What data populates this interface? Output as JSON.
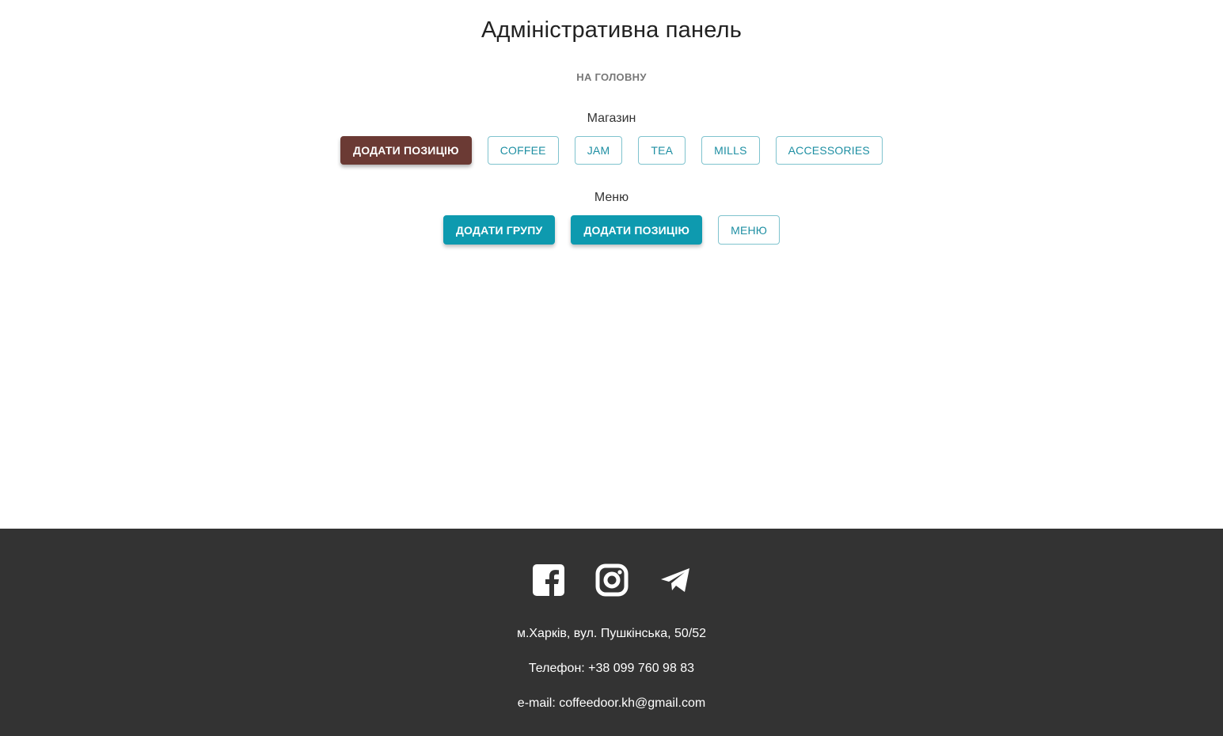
{
  "header": {
    "title": "Адміністративна панель",
    "home_link": "НА ГОЛОВНУ"
  },
  "shop": {
    "label": "Магазин",
    "buttons": [
      {
        "label": "ДОДАТИ ПОЗИЦІЮ",
        "style": "brown"
      },
      {
        "label": "COFFEE",
        "style": "outline"
      },
      {
        "label": "JAM",
        "style": "outline"
      },
      {
        "label": "TEA",
        "style": "outline"
      },
      {
        "label": "MILLS",
        "style": "outline"
      },
      {
        "label": "ACCESSORIES",
        "style": "outline"
      }
    ]
  },
  "menu": {
    "label": "Меню",
    "buttons": [
      {
        "label": "ДОДАТИ ГРУПУ",
        "style": "teal"
      },
      {
        "label": "ДОДАТИ ПОЗИЦІЮ",
        "style": "teal"
      },
      {
        "label": "МЕНЮ",
        "style": "outline"
      }
    ]
  },
  "footer": {
    "social_icons": [
      "facebook-icon",
      "instagram-icon",
      "telegram-icon"
    ],
    "address": "м.Харків, вул. Пушкінська, 50/52",
    "phone": "Телефон: +38 099 760 98 83",
    "email": "e-mail: coffeedoor.kh@gmail.com"
  },
  "colors": {
    "brown_button": "#6b3a34",
    "teal_button": "#0e9aaf",
    "outline_text": "#1e8fa3",
    "footer_bg": "#333333"
  }
}
